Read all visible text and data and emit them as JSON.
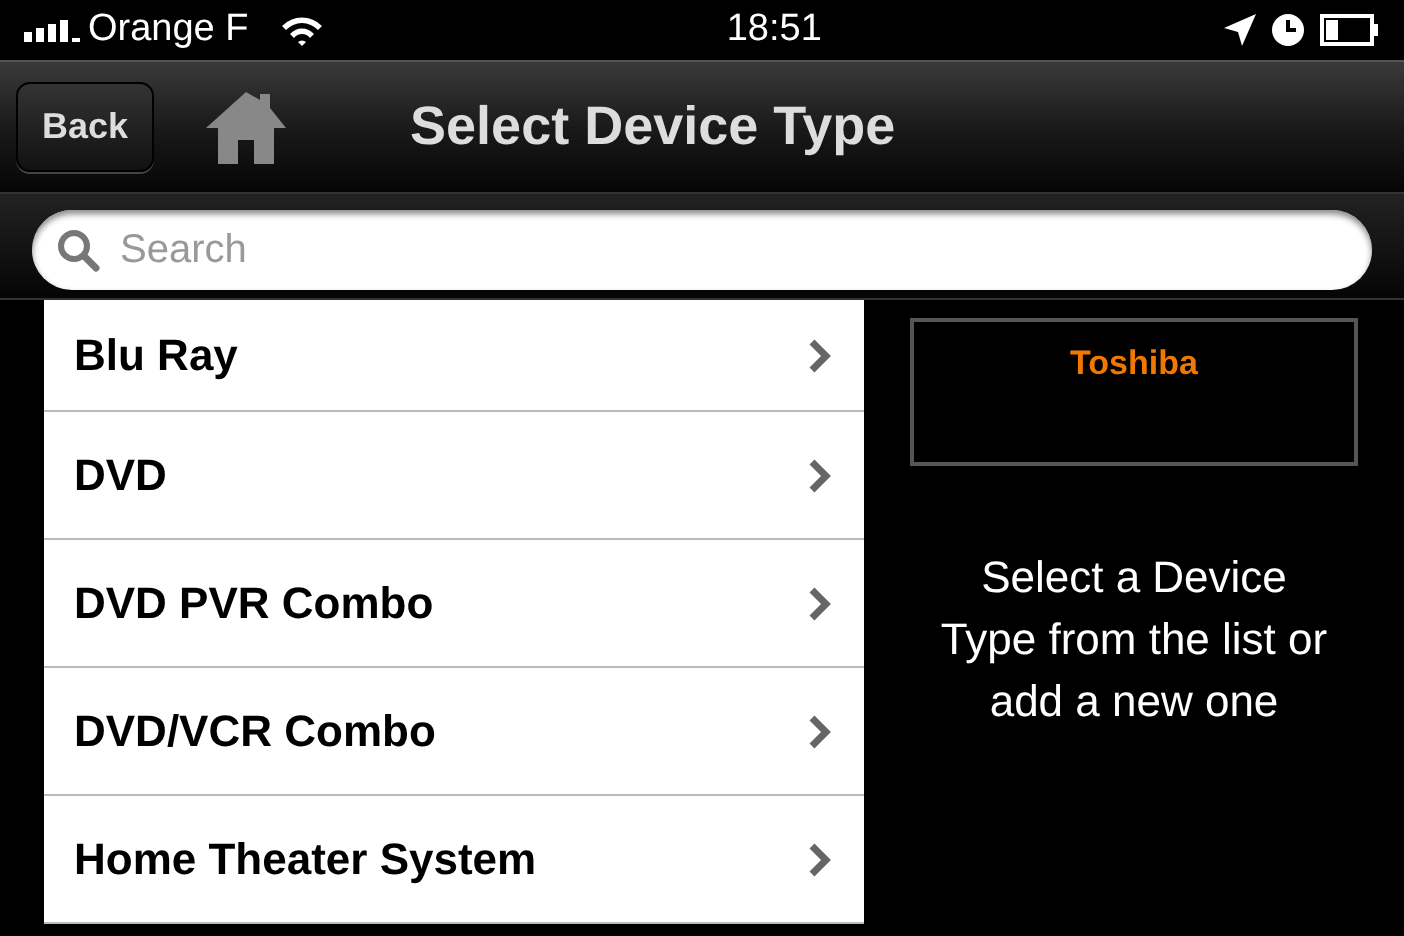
{
  "status_bar": {
    "carrier": "Orange F",
    "time": "18:51"
  },
  "nav": {
    "back": "Back",
    "title": "Select Device Type"
  },
  "search": {
    "placeholder": "Search"
  },
  "device_types": [
    {
      "label": "Blu Ray"
    },
    {
      "label": "DVD"
    },
    {
      "label": "DVD PVR Combo"
    },
    {
      "label": "DVD/VCR Combo"
    },
    {
      "label": "Home Theater System"
    }
  ],
  "brand": "Toshiba",
  "hint": "Select a Device Type from the list or add a new one"
}
